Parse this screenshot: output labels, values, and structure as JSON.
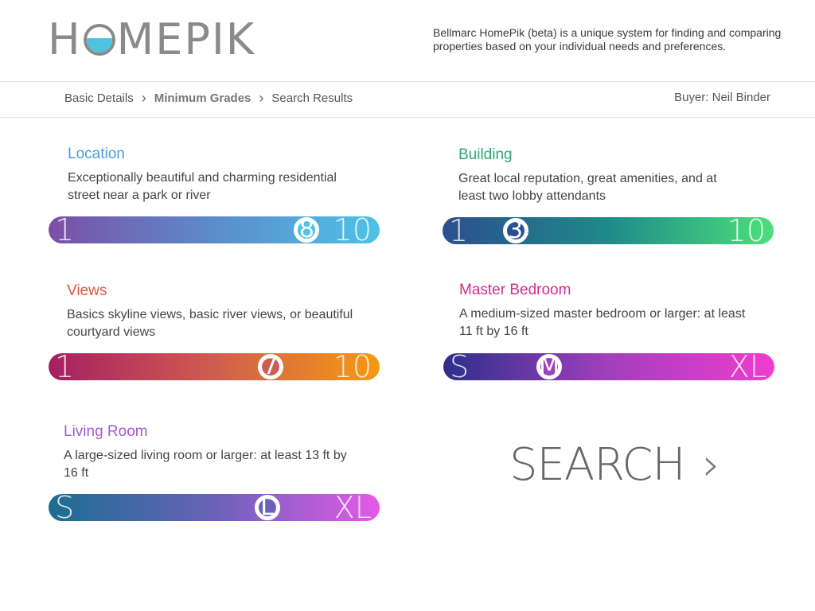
{
  "header": {
    "logo_text_left": "H",
    "logo_text_right": "MEPIK",
    "tagline": "Bellmarc HomePik (beta) is a unique system for finding and comparing properties based on your individual needs and preferences."
  },
  "breadcrumb": {
    "items": [
      {
        "label": "Basic Details"
      },
      {
        "label": "Minimum Grades"
      },
      {
        "label": "Search Results"
      }
    ],
    "separator": "›"
  },
  "buyer": "Buyer: Neil Binder",
  "criteria": {
    "location": {
      "title": "Location",
      "color": "#4a9cd3",
      "description": "Exceptionally beautiful and charming residential street near a park or river",
      "min_label": "1",
      "max_label": "10",
      "value": "8",
      "value_fraction": 0.78,
      "gradient": [
        "#7b4fa6",
        "#5c8cc9",
        "#4ec3e6"
      ]
    },
    "building": {
      "title": "Building",
      "color": "#2aa876",
      "description": "Great local reputation, great amenities, and at least two lobby attendants",
      "min_label": "1",
      "max_label": "10",
      "value": "3",
      "value_fraction": 0.22,
      "gradient": [
        "#2b4f8f",
        "#1f8a8a",
        "#4ce07a"
      ]
    },
    "views": {
      "title": "Views",
      "color": "#e0573a",
      "description": "Basics skyline views, basic river views, or beautiful courtyard views",
      "min_label": "1",
      "max_label": "10",
      "value": "7",
      "value_fraction": 0.67,
      "gradient": [
        "#a61f63",
        "#cf5d4f",
        "#f59a12"
      ]
    },
    "master_bedroom": {
      "title": "Master Bedroom",
      "color": "#d12d8f",
      "description": "A medium-sized master bedroom or larger: at least 11 ft by 16 ft",
      "min_label": "S",
      "max_label": "XL",
      "value": "M",
      "value_fraction": 0.32,
      "gradient": [
        "#2d2f8a",
        "#a23fbd",
        "#f03ccf"
      ]
    },
    "living_room": {
      "title": "Living Room",
      "color": "#a35ad1",
      "description": "A large-sized living room or larger: at least 13 ft by 16 ft",
      "min_label": "S",
      "max_label": "XL",
      "value": "L",
      "value_fraction": 0.66,
      "gradient": [
        "#1b6e92",
        "#6a62b8",
        "#e45ae8"
      ]
    }
  },
  "search": {
    "label": "SEARCH",
    "chevron": "›"
  }
}
